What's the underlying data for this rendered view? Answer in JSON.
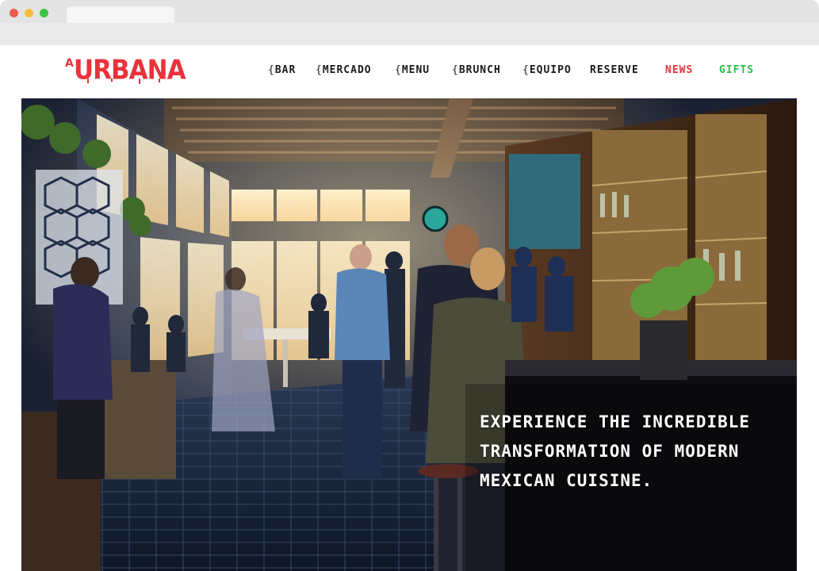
{
  "brand": {
    "logo_text": "URBANA",
    "logo_prefix": "A",
    "accent_color": "#e8333b",
    "gifts_color": "#2bbf4a"
  },
  "nav": {
    "items": [
      {
        "label": "BAR",
        "bracket": "{",
        "color": "#1b1b1b"
      },
      {
        "label": "MERCADO",
        "bracket": "{",
        "color": "#1b1b1b"
      },
      {
        "label": "MENU",
        "bracket": "{",
        "color": "#1b1b1b"
      },
      {
        "label": "BRUNCH",
        "bracket": "{",
        "color": "#1b1b1b"
      },
      {
        "label": "EQUIPO",
        "bracket": "{",
        "color": "#1b1b1b"
      },
      {
        "label": "RESERVE",
        "bracket": "",
        "color": "#1b1b1b"
      },
      {
        "label": "NEWS",
        "bracket": "",
        "color": "#e8333b"
      },
      {
        "label": "GIFTS",
        "bracket": "",
        "color": "#2bbf4a"
      }
    ]
  },
  "hero": {
    "tagline_lines": [
      "EXPERIENCE THE INCREDIBLE",
      "TRANSFORMATION OF MODERN",
      "MEXICAN CUISINE."
    ]
  }
}
